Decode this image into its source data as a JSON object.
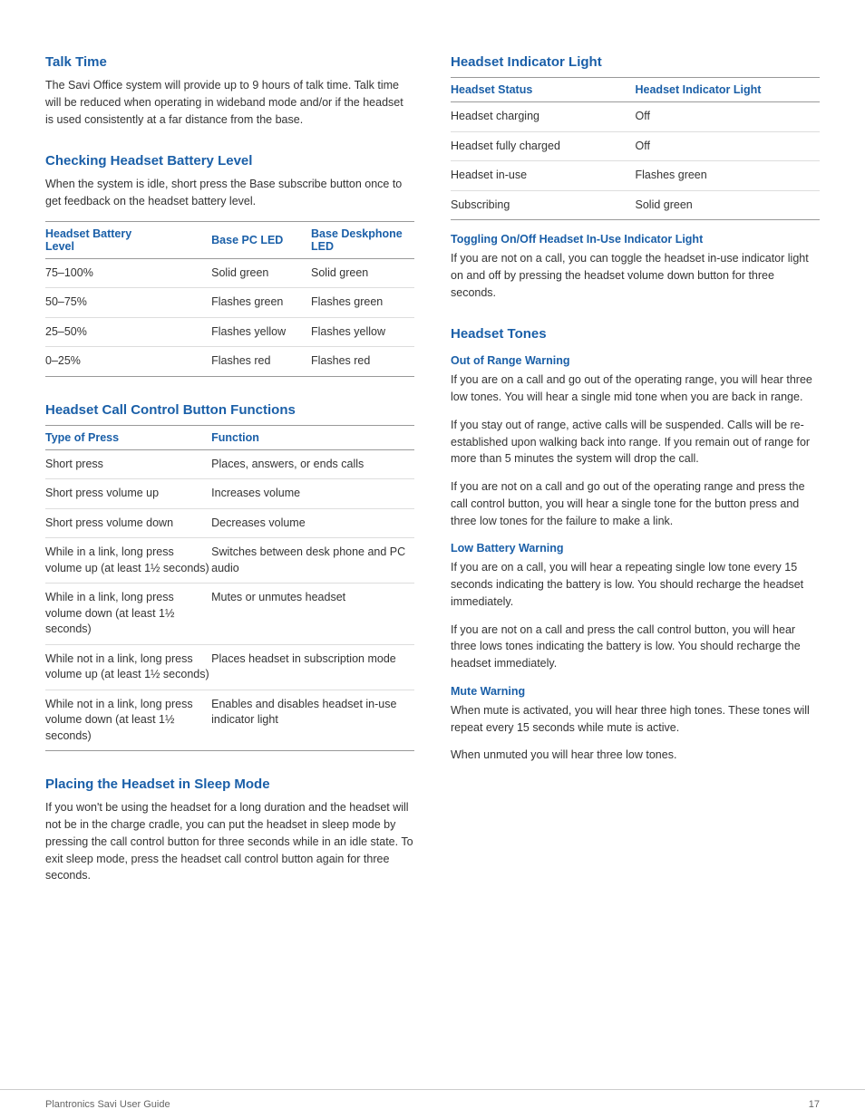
{
  "page": {
    "footer_left": "Plantronics Savi User Guide",
    "footer_right": "17"
  },
  "talk_time": {
    "title": "Talk Time",
    "text": "The Savi Office system will provide up to 9 hours of talk time. Talk time will be reduced when operating in wideband mode and/or if the headset is used consistently at a far distance from the base."
  },
  "battery_level": {
    "title": "Checking Headset Battery Level",
    "text": "When the system is idle, short press the Base subscribe button once to get feedback on the headset battery level.",
    "table": {
      "headers": [
        "Headset Battery Level",
        "Base PC LED",
        "Base Deskphone LED"
      ],
      "rows": [
        [
          "75–100%",
          "Solid green",
          "Solid green"
        ],
        [
          "50–75%",
          "Flashes green",
          "Flashes green"
        ],
        [
          "25–50%",
          "Flashes yellow",
          "Flashes yellow"
        ],
        [
          "0–25%",
          "Flashes red",
          "Flashes red"
        ]
      ]
    }
  },
  "call_control": {
    "title": "Headset Call Control Button Functions",
    "table": {
      "headers": [
        "Type of Press",
        "Function"
      ],
      "rows": [
        [
          "Short press",
          "Places, answers, or ends calls"
        ],
        [
          "Short press volume up",
          "Increases volume"
        ],
        [
          "Short press volume down",
          "Decreases volume"
        ],
        [
          "While in a link, long press volume up (at least 1½ seconds)",
          "Switches between desk phone and PC audio"
        ],
        [
          "While in a link, long press volume down (at least 1½ seconds)",
          "Mutes or unmutes headset"
        ],
        [
          "While not in a link, long press volume up (at least 1½ seconds)",
          "Places headset in subscription mode"
        ],
        [
          "While not in a link, long press volume down (at least 1½ seconds)",
          "Enables and disables headset in-use indicator light"
        ]
      ]
    }
  },
  "sleep_mode": {
    "title": "Placing the Headset in Sleep Mode",
    "text": "If you won't be using the headset for a long duration and the headset will not be in the charge cradle, you can put the headset in sleep mode by pressing the call control button for three seconds while in an idle state. To exit sleep mode, press the headset call control button again for three seconds."
  },
  "headset_indicator": {
    "title": "Headset Indicator Light",
    "table": {
      "headers": [
        "Headset Status",
        "Headset Indicator Light"
      ],
      "rows": [
        [
          "Headset charging",
          "Off"
        ],
        [
          "Headset fully charged",
          "Off"
        ],
        [
          "Headset in-use",
          "Flashes green"
        ],
        [
          "Subscribing",
          "Solid green"
        ]
      ]
    },
    "toggling_title": "Toggling On/Off Headset In-Use Indicator Light",
    "toggling_text": "If you are not on a call, you can toggle the headset in-use indicator light on and off by pressing the headset volume down button for three seconds."
  },
  "headset_tones": {
    "title": "Headset Tones",
    "out_of_range": {
      "title": "Out of Range Warning",
      "paragraphs": [
        "If you are on a call and go out of the operating range, you will hear three low tones. You will hear a single mid tone when you are back in range.",
        "If you stay out of range, active calls will be suspended. Calls will be re-established upon walking back into range. If you remain out of range for more than 5 minutes the system will drop the call.",
        "If you are not on a call and go out of the operating range and press the call control button, you will hear a single tone for the button press and three low tones for the failure to make a link."
      ]
    },
    "low_battery": {
      "title": "Low Battery Warning",
      "paragraphs": [
        "If you are on a call, you will hear a repeating single low tone every 15 seconds indicating the battery is low. You should recharge the headset immediately.",
        "If you are not on a call and press the call control button, you will hear three lows tones indicating the battery is low. You should recharge the headset immediately."
      ]
    },
    "mute_warning": {
      "title": "Mute Warning",
      "paragraphs": [
        "When mute is activated, you will hear three high tones. These tones will repeat every 15 seconds while mute is active.",
        "When unmuted you will hear three low tones."
      ]
    }
  }
}
